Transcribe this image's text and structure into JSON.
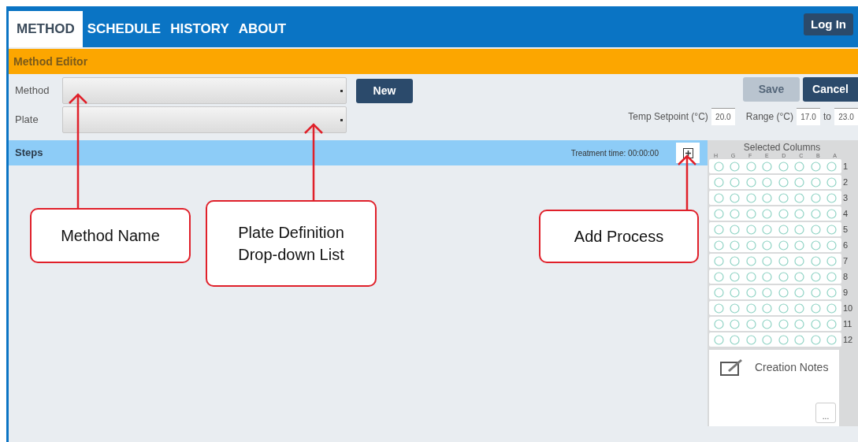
{
  "tabs": [
    {
      "label": "METHOD",
      "selected": true
    },
    {
      "label": "SCHEDULE",
      "selected": false
    },
    {
      "label": "HISTORY",
      "selected": false
    },
    {
      "label": "ABOUT",
      "selected": false
    }
  ],
  "login_button": "Log In",
  "section_title": "Method Editor",
  "form": {
    "method": {
      "label": "Method"
    },
    "plate": {
      "label": "Plate"
    },
    "new_button": "New",
    "save_button": {
      "label": "Save",
      "disabled": true
    },
    "cancel_button": "Cancel",
    "temp_setpoint": {
      "label": "Temp Setpoint (°C)",
      "value": "20.0"
    },
    "range": {
      "label": "Range (°C)",
      "from": "17.0",
      "separator": "to",
      "to": "23.0"
    }
  },
  "steps": {
    "title": "Steps",
    "treatment_time": "Treatment time: 00:00:00"
  },
  "selected_columns": {
    "title": "Selected Columns",
    "column_labels": [
      "H",
      "G",
      "F",
      "E",
      "D",
      "C",
      "B",
      "A"
    ],
    "row_labels": [
      "1",
      "2",
      "3",
      "4",
      "5",
      "6",
      "7",
      "8",
      "9",
      "10",
      "11",
      "12"
    ]
  },
  "creation_notes": {
    "label": "Creation Notes",
    "more_button": "..."
  },
  "callouts": [
    {
      "text": "Method Name"
    },
    {
      "text": "Plate Definition Drop-down List"
    },
    {
      "text": "Add Process"
    }
  ]
}
